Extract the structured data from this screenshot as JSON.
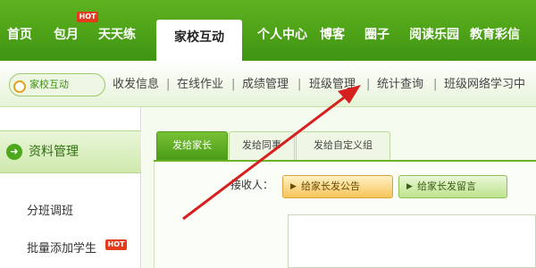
{
  "top_nav": {
    "items": [
      "首页",
      "包月",
      "天天练",
      "家校互动",
      "个人中心",
      "博客",
      "圈子",
      "阅读乐园",
      "教育彩信"
    ],
    "hot_badge": "HOT"
  },
  "sub_nav": {
    "current": "家校互动",
    "items": [
      "收发信息",
      "在线作业",
      "成绩管理",
      "班级管理",
      "统计查询",
      "班级网络学习中"
    ],
    "separator": "|"
  },
  "sidebar": {
    "header": "资料管理",
    "items": [
      "分班调班",
      "批量添加学生"
    ],
    "hot_badge": "HOT"
  },
  "tabs": [
    "发给家长",
    "发给同事",
    "发给自定义组"
  ],
  "form": {
    "recipient_label": "接收人：",
    "buttons": [
      "给家长发公告",
      "给家长发留言"
    ]
  },
  "colors": {
    "nav_green": "#4ba518",
    "annotation_red": "#d61f1f",
    "hot_red": "#e23b1d"
  }
}
